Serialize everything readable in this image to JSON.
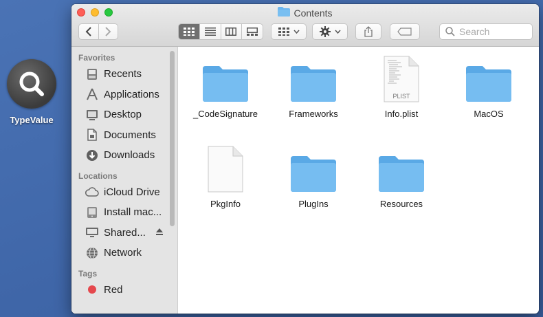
{
  "desktop": {
    "icon_label": "TypeValue"
  },
  "window": {
    "title": "Contents",
    "search": {
      "placeholder": "Search"
    }
  },
  "sidebar": {
    "favorites_header": "Favorites",
    "favorites": [
      {
        "label": "Recents",
        "icon": "recents-icon"
      },
      {
        "label": "Applications",
        "icon": "applications-icon"
      },
      {
        "label": "Desktop",
        "icon": "desktop-icon"
      },
      {
        "label": "Documents",
        "icon": "documents-icon"
      },
      {
        "label": "Downloads",
        "icon": "downloads-icon"
      }
    ],
    "locations_header": "Locations",
    "locations": [
      {
        "label": "iCloud Drive",
        "icon": "cloud-icon"
      },
      {
        "label": "Install mac...",
        "icon": "disk-icon"
      },
      {
        "label": "Shared...",
        "icon": "display-icon"
      },
      {
        "label": "Network",
        "icon": "network-icon"
      }
    ],
    "tags_header": "Tags",
    "tags": [
      {
        "label": "Red",
        "color": "#e5484d"
      }
    ]
  },
  "files": [
    {
      "name": "_CodeSignature",
      "kind": "folder"
    },
    {
      "name": "Frameworks",
      "kind": "folder"
    },
    {
      "name": "Info.plist",
      "kind": "plist",
      "badge": "PLIST"
    },
    {
      "name": "MacOS",
      "kind": "folder"
    },
    {
      "name": "PkgInfo",
      "kind": "document"
    },
    {
      "name": "PlugIns",
      "kind": "folder"
    },
    {
      "name": "Resources",
      "kind": "folder"
    }
  ],
  "colors": {
    "folder": "#6db6ee",
    "folder_tab": "#8fc8f3",
    "active_view": "#707070"
  }
}
